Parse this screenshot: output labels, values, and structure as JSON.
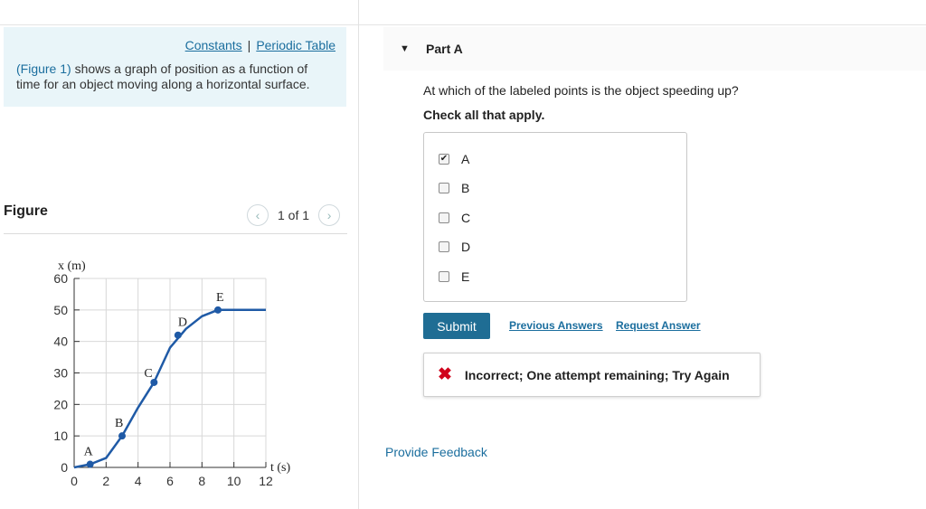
{
  "left_panel": {
    "links": {
      "constants": "Constants",
      "separator": "|",
      "periodic_table": "Periodic Table"
    },
    "intro": {
      "figure_ref": "(Figure 1)",
      "text": " shows a graph of position as a function of time for an object moving along a horizontal surface."
    },
    "figure": {
      "title": "Figure",
      "pager": "1 of 1",
      "prev_icon": "chevron-left-icon",
      "next_icon": "chevron-right-icon"
    }
  },
  "chart_data": {
    "type": "line",
    "xlabel": "t (s)",
    "ylabel": "x (m)",
    "xlim": [
      0,
      12
    ],
    "ylim": [
      0,
      60
    ],
    "x_ticks": [
      0,
      2,
      4,
      6,
      8,
      10,
      12
    ],
    "y_ticks": [
      0,
      10,
      20,
      30,
      40,
      50,
      60
    ],
    "grid": true,
    "series": [
      {
        "x": [
          0,
          1,
          2,
          3,
          4,
          5,
          6,
          7,
          8,
          9,
          10,
          11,
          12
        ],
        "y": [
          0,
          1,
          3,
          10,
          19,
          27,
          38,
          44,
          48,
          50,
          50,
          50,
          50
        ]
      }
    ],
    "points": [
      {
        "label": "A",
        "x": 1,
        "y": 1
      },
      {
        "label": "B",
        "x": 3,
        "y": 10
      },
      {
        "label": "C",
        "x": 5,
        "y": 27
      },
      {
        "label": "D",
        "x": 6.5,
        "y": 42
      },
      {
        "label": "E",
        "x": 9,
        "y": 50
      }
    ],
    "line_color": "#1f5aa6"
  },
  "part_a": {
    "title": "Part A",
    "question": "At which of the labeled points is the object speeding up?",
    "instruction": "Check all that apply.",
    "options": [
      {
        "label": "A",
        "checked": true
      },
      {
        "label": "B",
        "checked": false
      },
      {
        "label": "C",
        "checked": false
      },
      {
        "label": "D",
        "checked": false
      },
      {
        "label": "E",
        "checked": false
      }
    ],
    "submit_label": "Submit",
    "previous_answers": "Previous Answers",
    "request_answer": "Request Answer",
    "feedback": "Incorrect; One attempt remaining; Try Again",
    "provide_feedback": "Provide Feedback"
  },
  "colors": {
    "accent": "#1f6d94",
    "link": "#1b6e9e",
    "error": "#d0021b",
    "intro_bg": "#e9f5f9"
  }
}
